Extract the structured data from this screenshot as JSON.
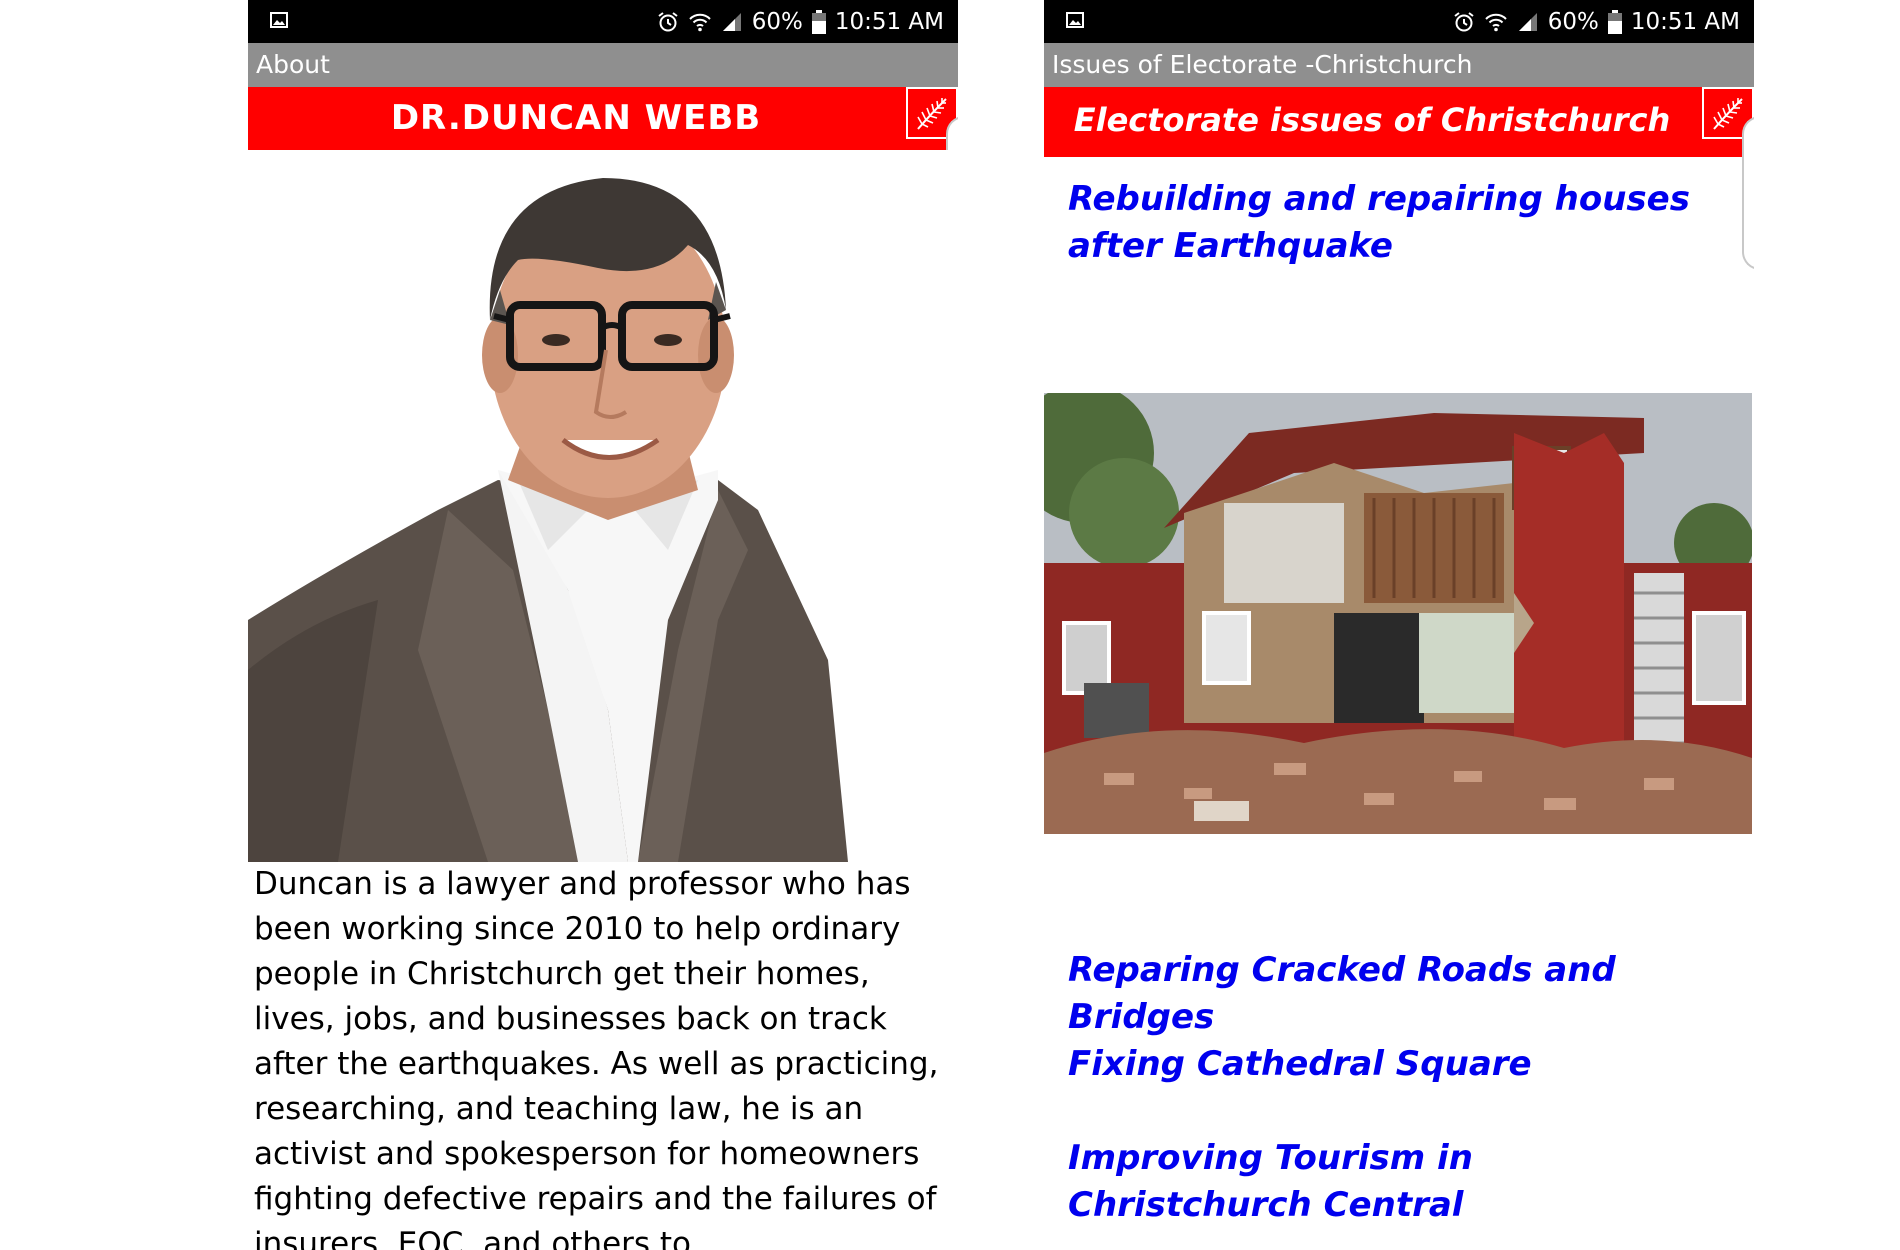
{
  "status_bar": {
    "battery": "60%",
    "time": "10:51 AM",
    "icons": [
      "gallery-icon",
      "alarm-icon",
      "wifi-icon",
      "signal-icon",
      "battery-icon"
    ]
  },
  "about_screen": {
    "title_bar": "About",
    "header": "DR.DUNCAN WEBB",
    "header_icon": "fern-icon",
    "bio": "Duncan is a lawyer and professor who has been working since 2010 to help ordinary people in Christchurch get their homes, lives, jobs, and businesses back on track after the earthquakes. As well as practicing, researching, and teaching law, he is an activist and spokesperson for homeowners fighting defective repairs and the failures of insurers, EQC, and others to"
  },
  "issues_screen": {
    "title_bar": "Issues of Electorate -Christchurch",
    "header": "Electorate issues of Christchurch",
    "header_icon": "fern-icon",
    "issues": [
      "Rebuilding and repairing houses after Earthquake",
      "Reparing Cracked Roads and Bridges",
      "Fixing Cathedral Square",
      "Improving Tourism in Christchurch Central"
    ]
  },
  "colors": {
    "header_red": "#ff0000",
    "title_bar_gray": "#8f8f8f",
    "status_bar": "#000000",
    "link_blue": "#0000ee"
  }
}
